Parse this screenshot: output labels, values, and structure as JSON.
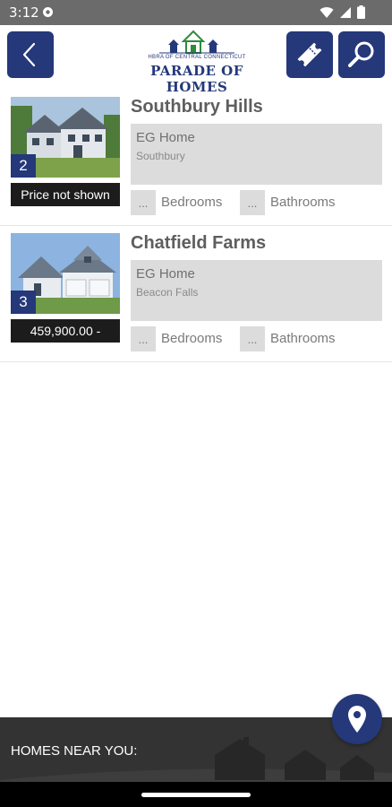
{
  "status_bar": {
    "time": "3:12",
    "icons": [
      "notification-icon",
      "wifi-icon",
      "signal-icon",
      "battery-icon"
    ]
  },
  "header": {
    "logo_subtitle": "HBRA OF CENTRAL CONNECTICUT",
    "logo_title": "PARADE OF HOMES",
    "icons": [
      "back-icon",
      "ticket-icon",
      "search-icon"
    ]
  },
  "listings": [
    {
      "number": "2",
      "name": "Southbury Hills",
      "builder": "EG Home",
      "town": "Southbury",
      "price": "Price not shown",
      "bedrooms_value": "...",
      "bedrooms_label": "Bedrooms",
      "bathrooms_value": "...",
      "bathrooms_label": "Bathrooms"
    },
    {
      "number": "3",
      "name": "Chatfield Farms",
      "builder": "EG Home",
      "town": "Beacon Falls",
      "price": "459,900.00 -",
      "bedrooms_value": "...",
      "bedrooms_label": "Bedrooms",
      "bathrooms_value": "...",
      "bathrooms_label": "Bathrooms"
    }
  ],
  "footer": {
    "label": "HOMES NEAR YOU:",
    "map_icon": "map-pin-icon"
  },
  "colors": {
    "brand_navy": "#24387a",
    "status_bar": "#6b6b6b",
    "info_box": "#dcdcdc",
    "footer": "#333333"
  }
}
